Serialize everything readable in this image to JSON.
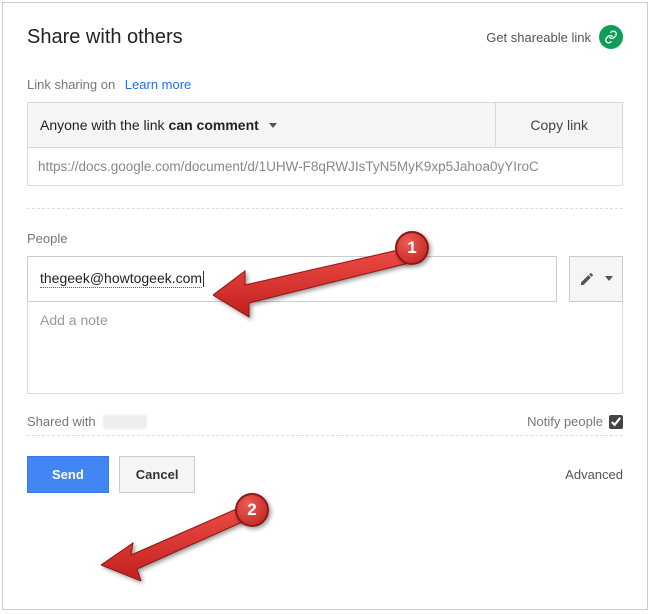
{
  "header": {
    "title": "Share with others",
    "shareable_link_label": "Get shareable link"
  },
  "link_sharing": {
    "status": "Link sharing on",
    "learn_more": "Learn more",
    "perm_prefix": "Anyone with the link ",
    "perm_bold": "can comment",
    "copy_label": "Copy link",
    "url": "https://docs.google.com/document/d/1UHW-F8qRWJIsTyN5MyK9xp5Jahoa0yYIroC"
  },
  "people": {
    "label": "People",
    "email_value": "thegeek@howtogeek.com",
    "note_placeholder": "Add a note"
  },
  "shared": {
    "label": "Shared with",
    "notify_label": "Notify people",
    "notify_checked": true
  },
  "footer": {
    "send": "Send",
    "cancel": "Cancel",
    "advanced": "Advanced"
  },
  "annotations": {
    "badge1": "1",
    "badge2": "2"
  }
}
